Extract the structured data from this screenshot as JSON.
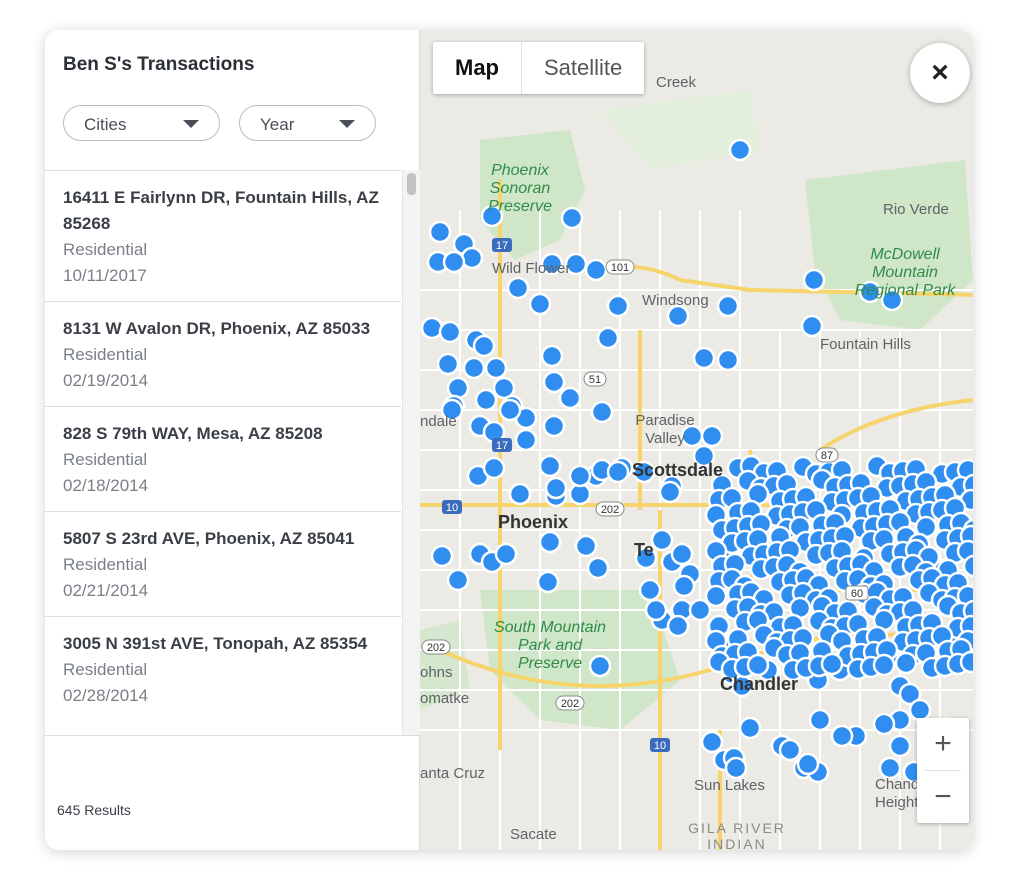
{
  "panel": {
    "title": "Ben S's Transactions",
    "filters": [
      {
        "label": "Cities"
      },
      {
        "label": "Year"
      }
    ],
    "transactions": [
      {
        "address": "16411 E Fairlynn DR, Fountain Hills, AZ 85268",
        "type": "Residential",
        "date": "10/11/2017"
      },
      {
        "address": "8131 W Avalon DR, Phoenix, AZ 85033",
        "type": "Residential",
        "date": "02/19/2014"
      },
      {
        "address": "828 S 79th WAY, Mesa, AZ 85208",
        "type": "Residential",
        "date": "02/18/2014"
      },
      {
        "address": "5807 S 23rd AVE, Phoenix, AZ 85041",
        "type": "Residential",
        "date": "02/21/2014"
      },
      {
        "address": "3005 N 391st AVE, Tonopah, AZ 85354",
        "type": "Residential",
        "date": "02/28/2014"
      }
    ],
    "results": "645 Results"
  },
  "map": {
    "toggle": {
      "map": "Map",
      "satellite": "Satellite"
    },
    "close": "×",
    "zoom_in": "+",
    "zoom_out": "−",
    "marker_color": "#2f8ef0",
    "labels": {
      "creek": "Creek",
      "sonoran": "Phoenix Sonoran Preserve",
      "rio_verde": "Rio Verde",
      "mcdowell": "McDowell Mountain Regional Park",
      "wild_flower": "Wild Flower",
      "windsong": "Windsong",
      "fountain_hills": "Fountain Hills",
      "paradise_valley": "Paradise Valley",
      "scottsdale": "Scottsdale",
      "phoenix": "Phoenix",
      "tempe": "Te",
      "south_mountain": "South Mountain Park and Preserve",
      "chandler": "Chandler",
      "chandler_heights": "Chandler Heights",
      "sun_lakes": "Sun Lakes",
      "santa_cruz": "anta Cruz",
      "sacate": "Sacate",
      "gila_river": "GILA RIVER INDIAN",
      "johns": "ohns",
      "komatke": "omatke",
      "glendale": "ndale"
    },
    "shields": [
      "17",
      "101",
      "51",
      "10",
      "202",
      "87",
      "60",
      "202",
      "202",
      "10",
      "17"
    ]
  }
}
